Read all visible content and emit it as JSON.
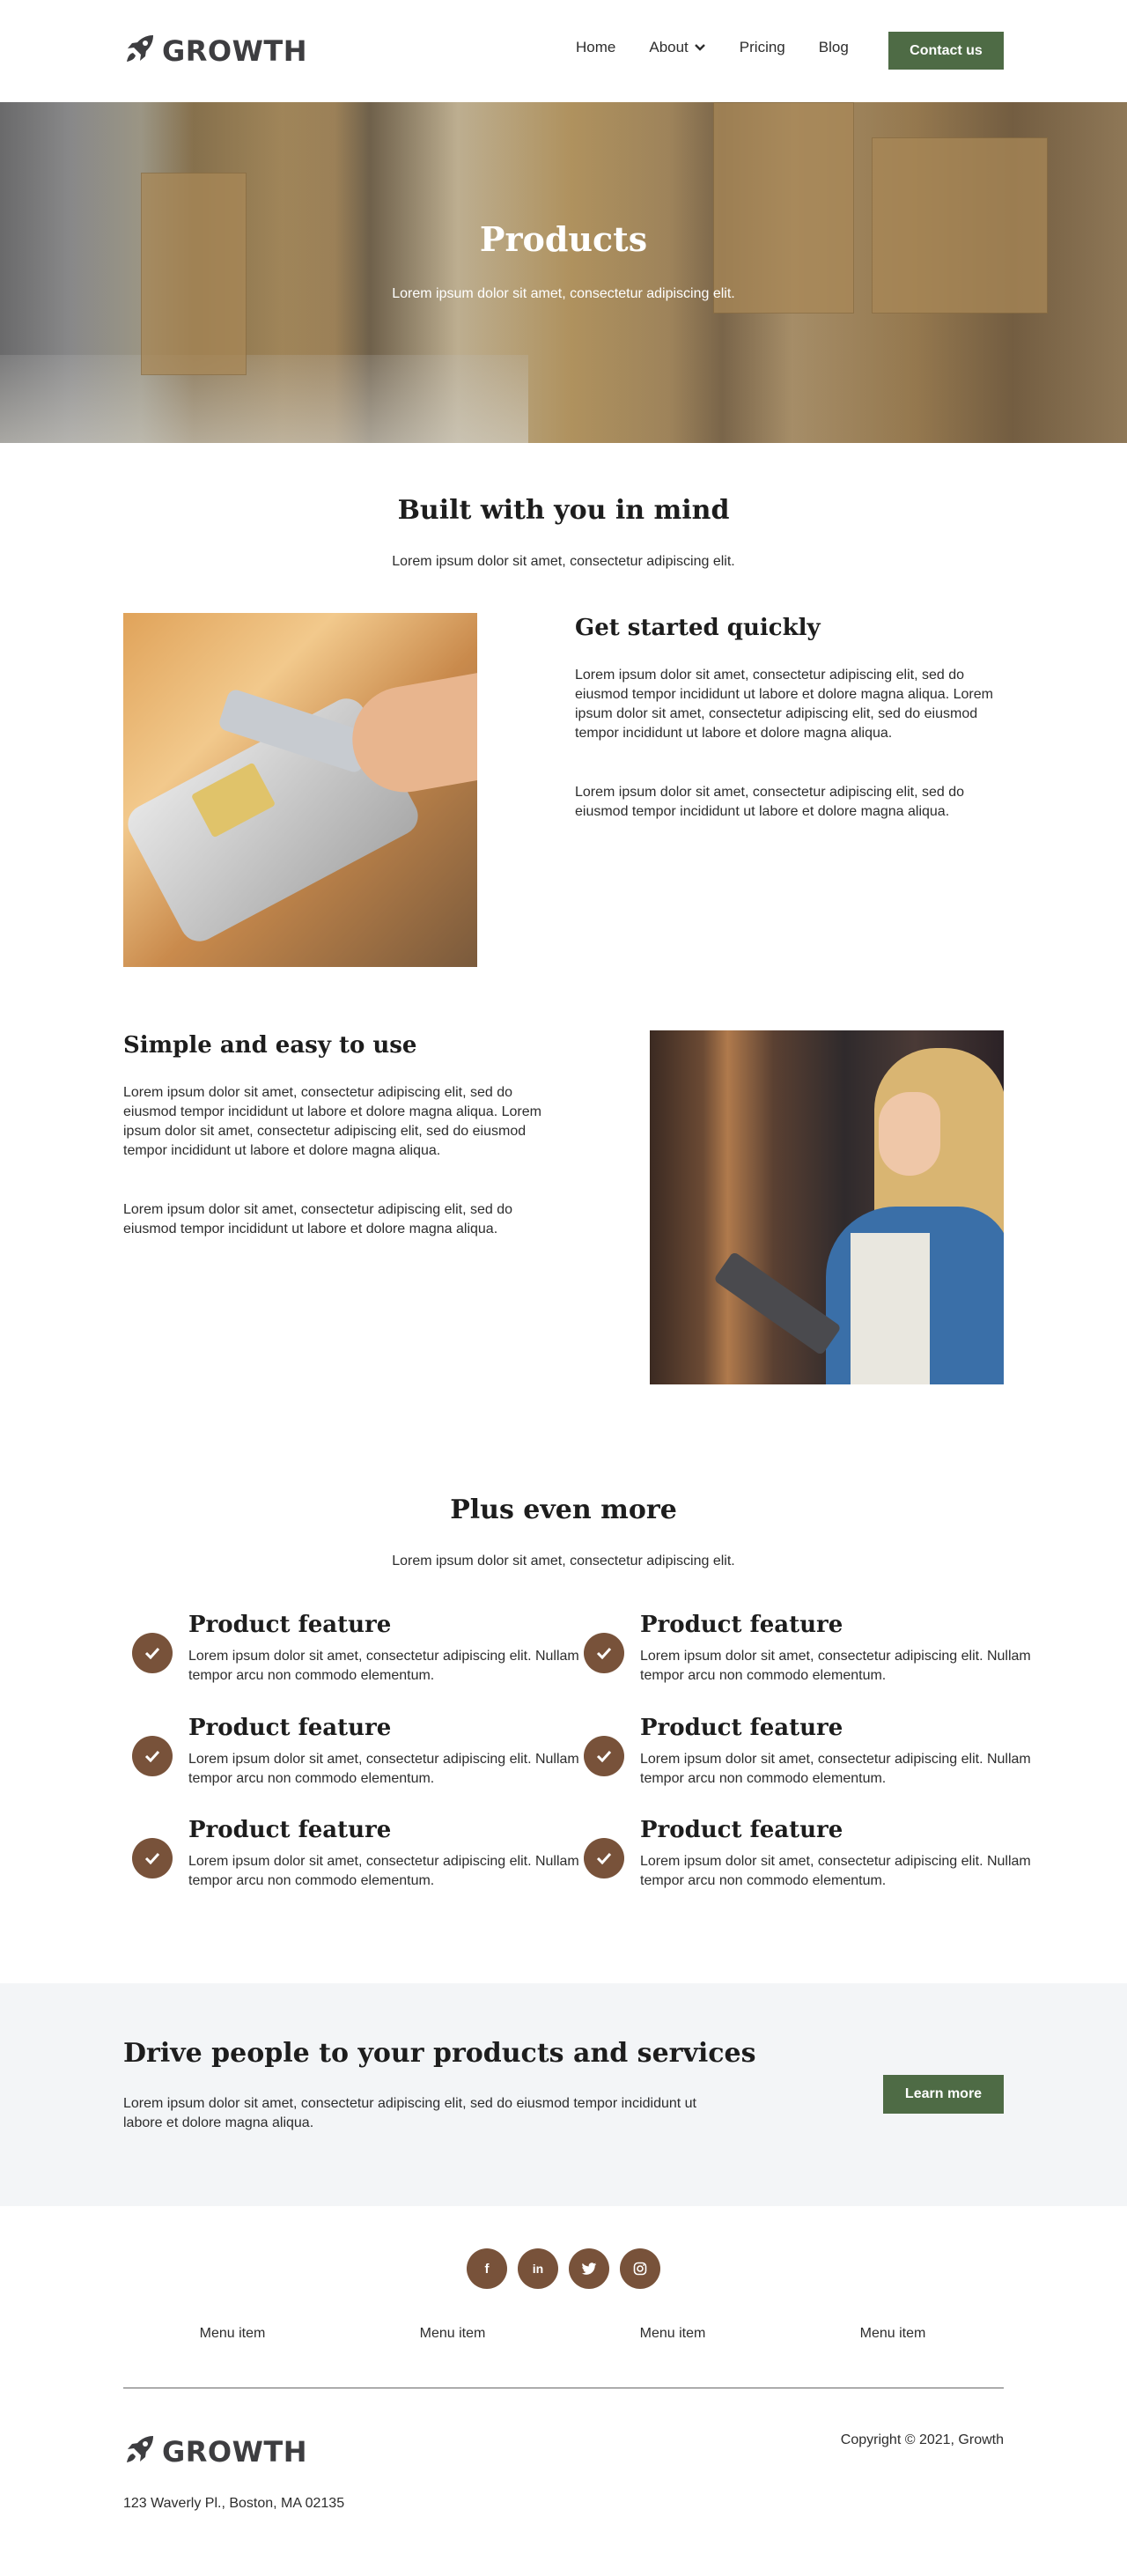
{
  "brand": {
    "name": "GROWTH",
    "logo_icon": "rocket-icon",
    "accent": "#4e6b45",
    "secondary": "#78523a"
  },
  "nav": {
    "items": [
      "Home",
      "About",
      "Pricing",
      "Blog"
    ],
    "about_icon": "chevron-down-icon",
    "contact_label": "Contact us"
  },
  "hero": {
    "title": "Products",
    "subtitle": "Lorem ipsum dolor sit amet, consectetur adipiscing elit."
  },
  "intro": {
    "title": "Built with you in mind",
    "subtitle": "Lorem ipsum dolor sit amet, consectetur adipiscing elit."
  },
  "block1": {
    "title": "Get started quickly",
    "p1": "Lorem ipsum dolor sit amet, consectetur adipiscing elit, sed do eiusmod tempor incididunt ut labore et dolore magna aliqua. Lorem ipsum dolor sit amet, consectetur adipiscing elit, sed do eiusmod tempor incididunt ut labore et dolore magna aliqua.",
    "p2": "Lorem ipsum dolor sit amet, consectetur adipiscing elit, sed do eiusmod tempor incididunt ut labore et dolore magna aliqua."
  },
  "block2": {
    "title": "Simple and easy to use",
    "p1": "Lorem ipsum dolor sit amet, consectetur adipiscing elit, sed do eiusmod tempor incididunt ut labore et dolore magna aliqua. Lorem ipsum dolor sit amet, consectetur adipiscing elit, sed do eiusmod tempor incididunt ut labore et dolore magna aliqua.",
    "p2": "Lorem ipsum dolor sit amet, consectetur adipiscing elit, sed do eiusmod tempor incididunt ut labore et dolore magna aliqua."
  },
  "more": {
    "title": "Plus even more",
    "subtitle": "Lorem ipsum dolor sit amet, consectetur adipiscing elit.",
    "check_icon": "check-icon",
    "features": [
      {
        "title": "Product feature",
        "text": "Lorem ipsum dolor sit amet, consectetur adipiscing elit. Nullam tempor arcu non commodo elementum."
      },
      {
        "title": "Product feature",
        "text": "Lorem ipsum dolor sit amet, consectetur adipiscing elit. Nullam tempor arcu non commodo elementum."
      },
      {
        "title": "Product feature",
        "text": "Lorem ipsum dolor sit amet, consectetur adipiscing elit. Nullam tempor arcu non commodo elementum."
      },
      {
        "title": "Product feature",
        "text": "Lorem ipsum dolor sit amet, consectetur adipiscing elit. Nullam tempor arcu non commodo elementum."
      },
      {
        "title": "Product feature",
        "text": "Lorem ipsum dolor sit amet, consectetur adipiscing elit. Nullam tempor arcu non commodo elementum."
      },
      {
        "title": "Product feature",
        "text": "Lorem ipsum dolor sit amet, consectetur adipiscing elit. Nullam tempor arcu non commodo elementum."
      }
    ]
  },
  "cta": {
    "title": "Drive people to your products and services",
    "text": "Lorem ipsum dolor sit amet, consectetur adipiscing elit, sed do eiusmod tempor incididunt ut labore et dolore magna aliqua.",
    "button": "Learn more"
  },
  "footer": {
    "socials": [
      {
        "icon": "facebook-icon",
        "glyph": "f"
      },
      {
        "icon": "linkedin-icon",
        "glyph": "in"
      },
      {
        "icon": "twitter-icon",
        "glyph": ""
      },
      {
        "icon": "instagram-icon",
        "glyph": ""
      }
    ],
    "menu": [
      "Menu item",
      "Menu item",
      "Menu item",
      "Menu item"
    ],
    "copyright": "Copyright © 2021, Growth",
    "address": "123 Waverly Pl., Boston, MA 02135"
  }
}
